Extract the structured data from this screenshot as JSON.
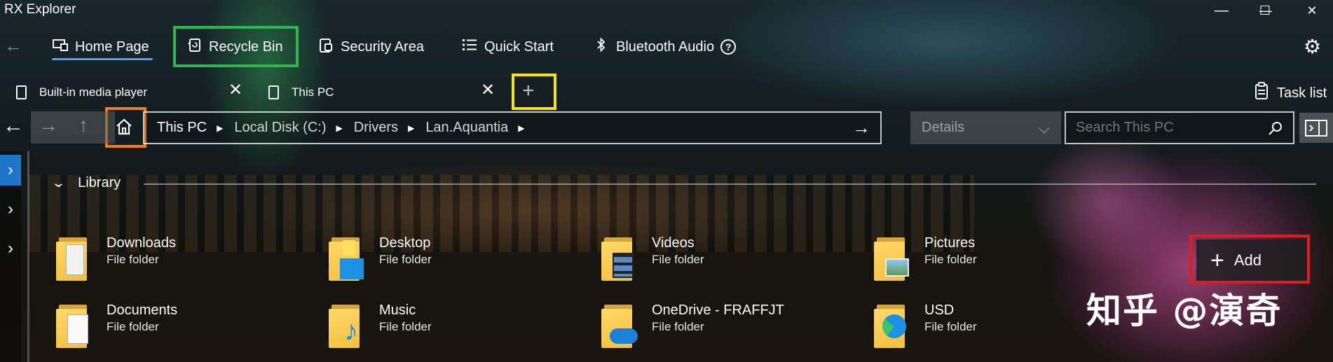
{
  "app": {
    "title": "RX Explorer"
  },
  "window_controls": {
    "minimize": "—",
    "maximize": "☐",
    "close": "✕"
  },
  "nav": {
    "back_icon": "←",
    "items": [
      {
        "label": "Home Page",
        "icon": "home-page-icon",
        "active": true
      },
      {
        "label": "Recycle Bin",
        "icon": "recycle-bin-icon"
      },
      {
        "label": "Security Area",
        "icon": "lock-icon"
      },
      {
        "label": "Quick Start",
        "icon": "list-icon"
      },
      {
        "label": "Bluetooth Audio",
        "icon": "bluetooth-icon"
      }
    ],
    "help_label": "?",
    "settings_icon": "⚙"
  },
  "tabs": {
    "items": [
      {
        "label": "Built-in media player",
        "close": "✕"
      },
      {
        "label": "This PC",
        "close": "✕"
      }
    ],
    "new_tab": "+",
    "task_list": {
      "label": "Task list"
    }
  },
  "address_bar": {
    "back_icon": "←",
    "forward_icon": "→",
    "up_icon": "↑",
    "breadcrumbs": [
      "This PC",
      "Local Disk (C:)",
      "Drivers",
      "Lan.Aquantia"
    ],
    "go_icon": "→"
  },
  "view_mode": {
    "label": "Details",
    "chevron": "⌵"
  },
  "search": {
    "placeholder": "Search This PC",
    "icon": "⌕"
  },
  "rail": {
    "chevron": "›"
  },
  "library": {
    "header": "Library",
    "chevron": "⌄",
    "items": [
      {
        "name": "Downloads",
        "type": "File folder"
      },
      {
        "name": "Desktop",
        "type": "File folder"
      },
      {
        "name": "Videos",
        "type": "File folder"
      },
      {
        "name": "Pictures",
        "type": "File folder"
      },
      {
        "name": "Documents",
        "type": "File folder"
      },
      {
        "name": "Music",
        "type": "File folder"
      },
      {
        "name": "OneDrive - FRAFFJT",
        "type": "File folder"
      },
      {
        "name": "USD",
        "type": "File folder"
      }
    ],
    "add_button": {
      "label": "Add",
      "icon": "+"
    }
  },
  "watermark": {
    "text": "知乎 @演奇"
  },
  "highlight_colors": {
    "recycle_bin": "#2db84a",
    "new_tab": "#f5e21c",
    "home": "#f07d22",
    "add": "#e21b1b"
  }
}
